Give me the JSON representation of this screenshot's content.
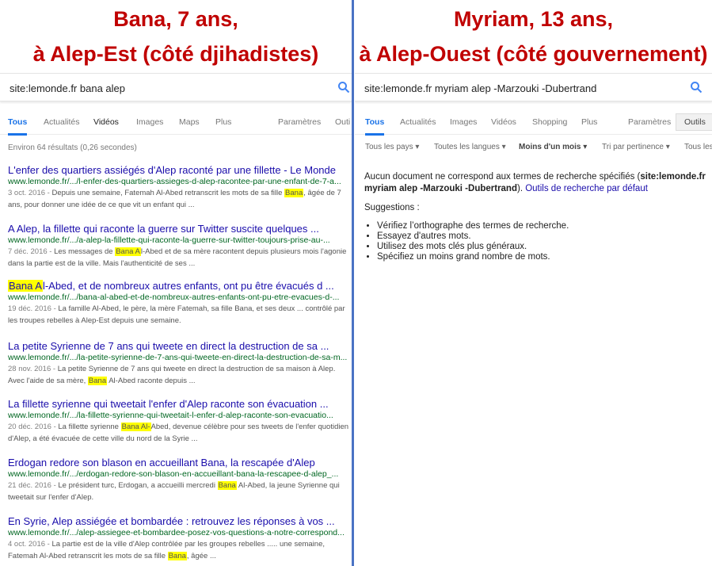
{
  "left": {
    "heading_line1": "Bana, 7 ans,",
    "heading_line2": "à Alep-Est (côté djihadistes)",
    "query": "site:lemonde.fr bana alep",
    "tabs": [
      "Tous",
      "Actualités",
      "Vidéos",
      "Images",
      "Maps",
      "Plus",
      "Paramètres",
      "Outi"
    ],
    "stats": "Environ 64 résultats (0,26 secondes)",
    "results": [
      {
        "title": "L'enfer des quartiers assiégés d'Alep raconté par une fillette - Le Monde",
        "url": "www.lemonde.fr/.../l-enfer-des-quartiers-assieges-d-alep-racontee-par-une-enfant-de-7-a...",
        "date": "3 oct. 2016 - ",
        "snippet_a": "Depuis une semaine, Fatemah Al-Abed retranscrit les mots de sa fille ",
        "highlight": "Bana",
        "snippet_b": ", âgée de 7 ans, pour donner une idée de ce que vit un enfant qui ..."
      },
      {
        "title": "A Alep, la fillette qui raconte la guerre sur Twitter suscite quelques ...",
        "url": "www.lemonde.fr/.../a-alep-la-fillette-qui-raconte-la-guerre-sur-twitter-toujours-prise-au-...",
        "date": "7 déc. 2016 - ",
        "snippet_a": "Les messages de ",
        "highlight": "Bana A",
        "snippet_b": "l-Abed et de sa mère racontent depuis plusieurs mois l'agonie dans la partie est de la ville. Mais l'authenticité de ses ..."
      },
      {
        "title_highlight": "Bana A",
        "title": "l-Abed, et de nombreux autres enfants, ont pu être évacués d ...",
        "url": "www.lemonde.fr/.../bana-al-abed-et-de-nombreux-autres-enfants-ont-pu-etre-evacues-d-...",
        "date": "19 déc. 2016 - ",
        "snippet_a": "La famille Al-Abed, le père, la mère Fatemah, sa fille Bana, et ses deux ... contrôlé par les troupes rebelles à Alep-Est depuis une semaine.",
        "highlight": "",
        "snippet_b": ""
      },
      {
        "title": "La petite Syrienne de 7 ans qui tweete en direct la destruction de sa ...",
        "url": "www.lemonde.fr/.../la-petite-syrienne-de-7-ans-qui-tweete-en-direct-la-destruction-de-sa-m...",
        "date": "28 nov. 2016 - ",
        "snippet_a": "La petite Syrienne de 7 ans qui tweete en direct la destruction de sa maison à Alep. Avec l'aide de sa mère, ",
        "highlight": "Bana",
        "snippet_b": " Al-Abed raconte depuis ..."
      },
      {
        "title": "La fillette syrienne qui tweetait l'enfer d'Alep raconte son évacuation ...",
        "url": "www.lemonde.fr/.../la-fillette-syrienne-qui-tweetait-l-enfer-d-alep-raconte-son-evacuatio...",
        "date": "20 déc. 2016 - ",
        "snippet_a": "La fillette syrienne ",
        "highlight": "Bana Al-",
        "snippet_b": "Abed, devenue célèbre pour ses tweets de l'enfer quotidien d'Alep, a été évacuée de cette ville du nord de la Syrie ..."
      },
      {
        "title": "Erdogan redore son blason en accueillant Bana, la rescapée d'Alep",
        "url": "www.lemonde.fr/.../erdogan-redore-son-blason-en-accueillant-bana-la-rescapee-d-alep_...",
        "date": "21 déc. 2016 - ",
        "snippet_a": "Le président turc, Erdogan, a accueilli mercredi ",
        "highlight": "Bana",
        "snippet_b": " Al-Abed, la jeune Syrienne qui tweetait sur l'enfer d'Alep."
      },
      {
        "title": "En Syrie, Alep assiégée et bombardée : retrouvez les réponses à vos ...",
        "url": "www.lemonde.fr/.../alep-assiegee-et-bombardee-posez-vos-questions-a-notre-correspond...",
        "date": "4 oct. 2016 - ",
        "snippet_a": "La partie est de la ville d'Alep contrôlée par les groupes rebelles ..... une semaine, Fatemah Al-Abed retranscrit les mots de sa fille ",
        "highlight": "Bana",
        "snippet_b": ", âgée ..."
      }
    ]
  },
  "right": {
    "heading_line1": "Myriam, 13 ans,",
    "heading_line2": "à Alep-Ouest (côté gouvernement)",
    "query": "site:lemonde.fr myriam alep -Marzouki  -Dubertrand",
    "tabs": [
      "Tous",
      "Actualités",
      "Images",
      "Vidéos",
      "Shopping",
      "Plus",
      "Paramètres",
      "Outils"
    ],
    "filters": [
      "Tous les pays ▾",
      "Toutes les langues ▾",
      "Moins d'un mois ▾",
      "Tri par pertinence ▾",
      "Tous les"
    ],
    "noresult_a": "Aucun document ne correspond aux termes de recherche spécifiés (",
    "noresult_query": "site:lemonde.fr myriam alep -Marzouki -Dubertrand",
    "noresult_b": "). ",
    "noresult_link": "Outils de recherche par défaut",
    "suggestions_title": "Suggestions :",
    "suggestions": [
      "Vérifiez l’orthographe des termes de recherche.",
      "Essayez d'autres mots.",
      "Utilisez des mots clés plus généraux.",
      "Spécifiez un moins grand nombre de mots."
    ]
  },
  "colors": {
    "heading": "#c00000",
    "divider": "#4a73c4",
    "link": "#1a0dab",
    "url": "#006621",
    "highlight": "#ffff00",
    "tab_active": "#1a73e8"
  }
}
